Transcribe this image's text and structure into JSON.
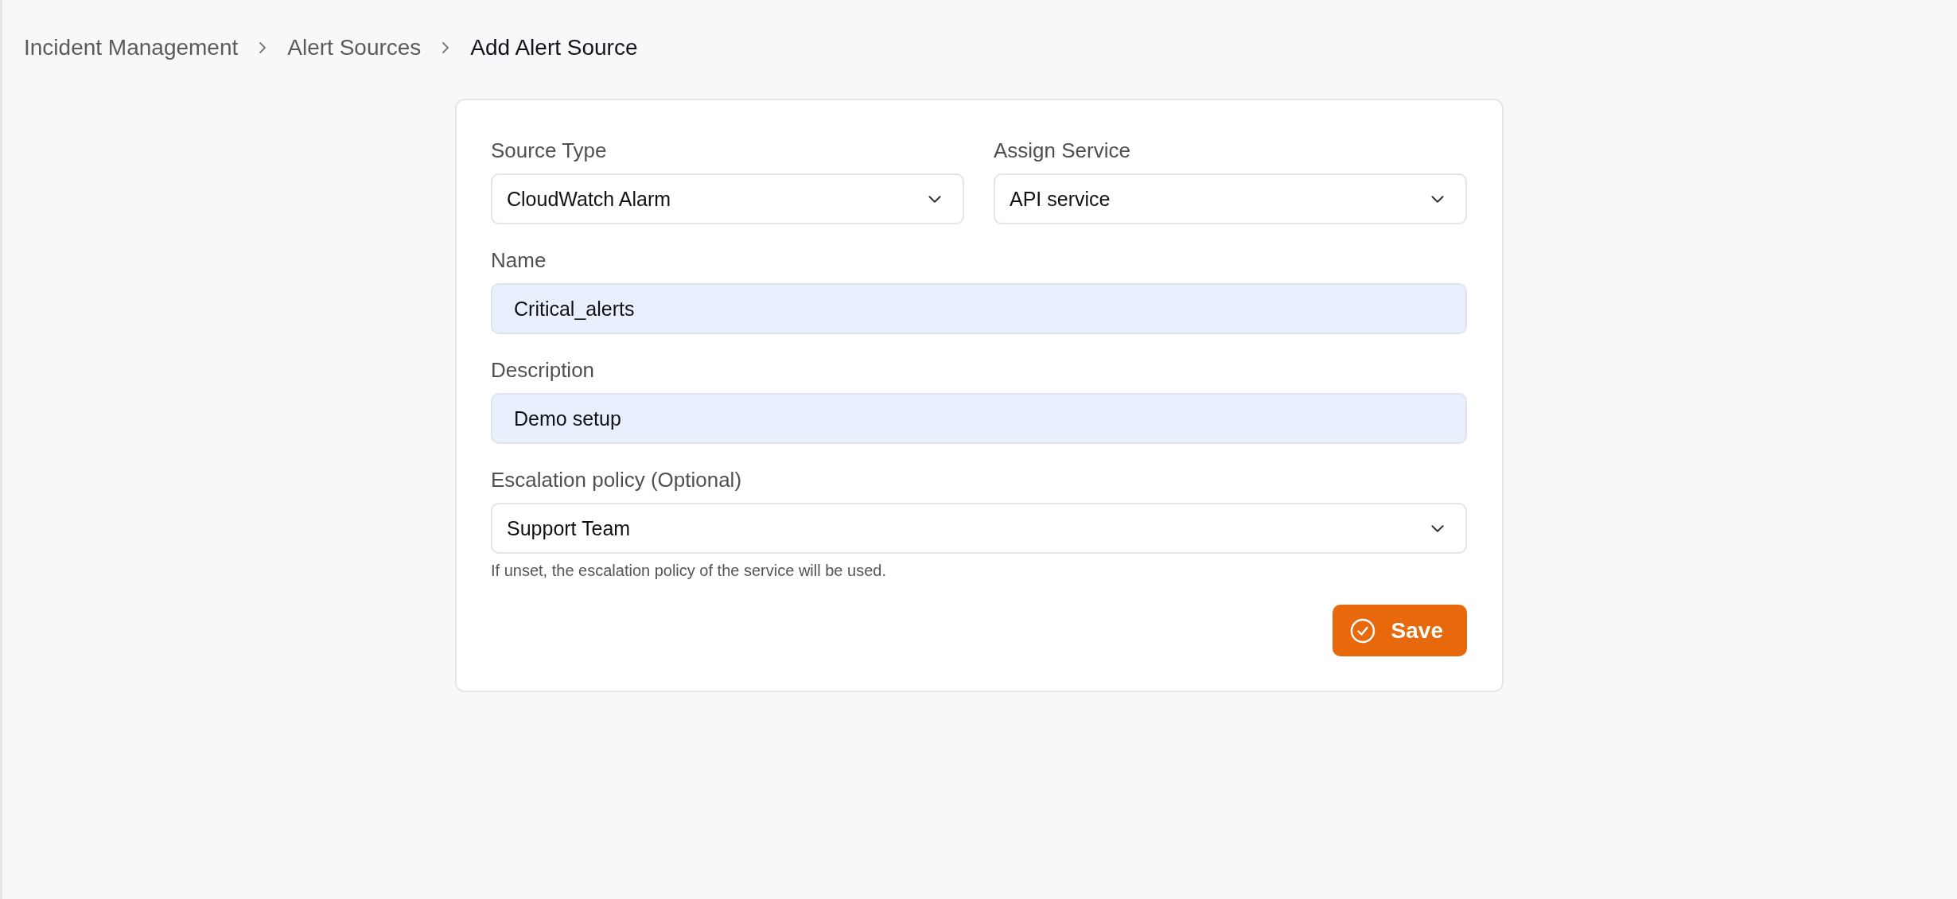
{
  "breadcrumb": [
    {
      "label": "Incident Management",
      "current": false
    },
    {
      "label": "Alert Sources",
      "current": false
    },
    {
      "label": "Add Alert Source",
      "current": true
    }
  ],
  "form": {
    "rows": [
      [
        {
          "label": "Source Type",
          "kind": "select",
          "value": "CloudWatch Alarm"
        },
        {
          "label": "Assign Service",
          "kind": "select",
          "value": "API service"
        }
      ],
      [
        {
          "label": "Name",
          "kind": "input",
          "value": "Critical_alerts"
        }
      ],
      [
        {
          "label": "Description",
          "kind": "input",
          "value": "Demo setup"
        }
      ],
      [
        {
          "label": "Escalation policy (Optional)",
          "kind": "select",
          "value": "Support Team",
          "hint": "If unset, the escalation policy of the service will be used."
        }
      ]
    ],
    "submit": {
      "label": "Save"
    }
  }
}
